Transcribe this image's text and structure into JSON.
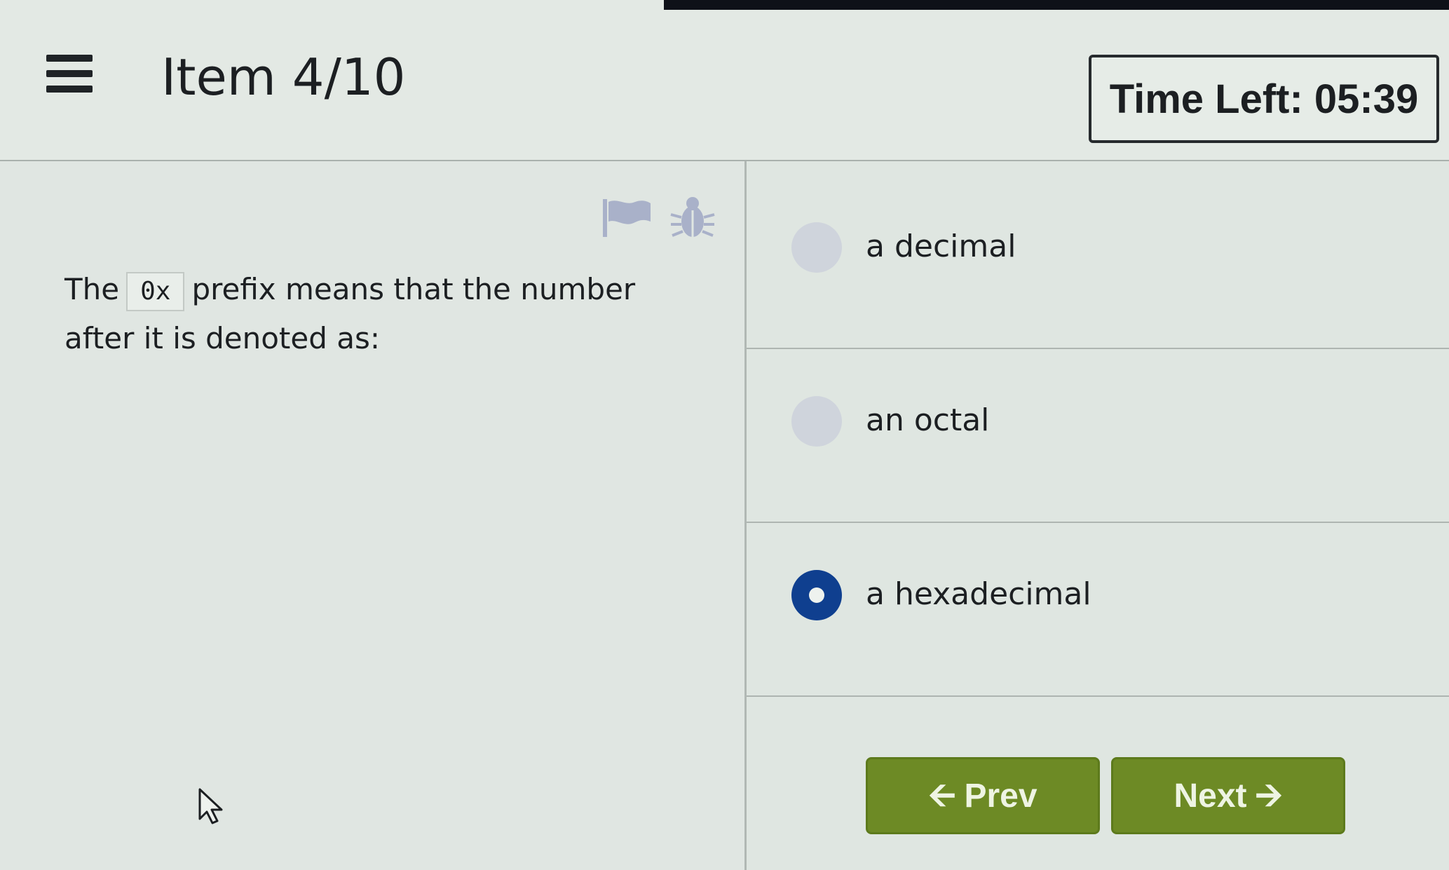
{
  "header": {
    "item_label": "Item 4/10",
    "timer_label": "Time Left:",
    "timer_value": "05:39"
  },
  "question": {
    "text_before": "The",
    "code": "0x",
    "text_after": "prefix means that the number after it is denoted as:",
    "flag_icon": "flag-icon",
    "bug_icon": "bug-icon"
  },
  "options": [
    {
      "label": "a decimal",
      "selected": false
    },
    {
      "label": "an octal",
      "selected": false
    },
    {
      "label": "a hexadecimal",
      "selected": true
    }
  ],
  "nav": {
    "prev_label": "Prev",
    "next_label": "Next",
    "prev_icon": "arrow-left-icon",
    "next_icon": "arrow-right-icon",
    "button_color": "#6d8a25"
  },
  "colors": {
    "selected_radio": "#0f3f8f",
    "unselected_radio": "#cfd4dc"
  }
}
